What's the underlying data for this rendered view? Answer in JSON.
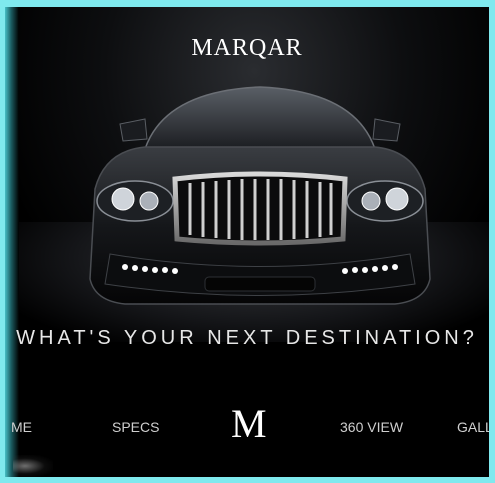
{
  "brand": {
    "logo_text": "MARQAR"
  },
  "hero": {
    "tagline": "WHAT'S YOUR NEXT DESTINATION?"
  },
  "nav": {
    "items": [
      {
        "label": "ME"
      },
      {
        "label": "SPECS"
      },
      {
        "label": "M"
      },
      {
        "label": "360 VIEW"
      },
      {
        "label": "GALL"
      }
    ]
  },
  "colors": {
    "frame": "#7fe9ee",
    "background": "#000000",
    "text": "#e7e7e7",
    "drl_lights": "#ffffff"
  }
}
